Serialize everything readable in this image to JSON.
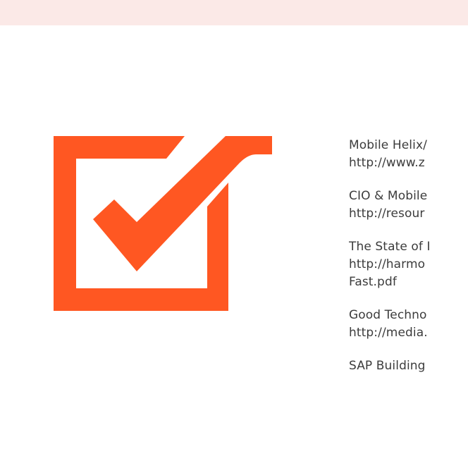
{
  "colors": {
    "accent": "#ff5722",
    "band": "#fbe9e7",
    "text": "#3c3c3c"
  },
  "icon": {
    "name": "checkbox-checked-icon"
  },
  "references": [
    {
      "lines": [
        "Mobile Helix/",
        "http://www.z"
      ]
    },
    {
      "lines": [
        "CIO & Mobile",
        "http://resour"
      ]
    },
    {
      "lines": [
        "The State of I",
        "http://harmo",
        "Fast.pdf"
      ]
    },
    {
      "lines": [
        "Good Techno",
        "http://media."
      ]
    },
    {
      "lines": [
        "SAP Building"
      ]
    }
  ]
}
